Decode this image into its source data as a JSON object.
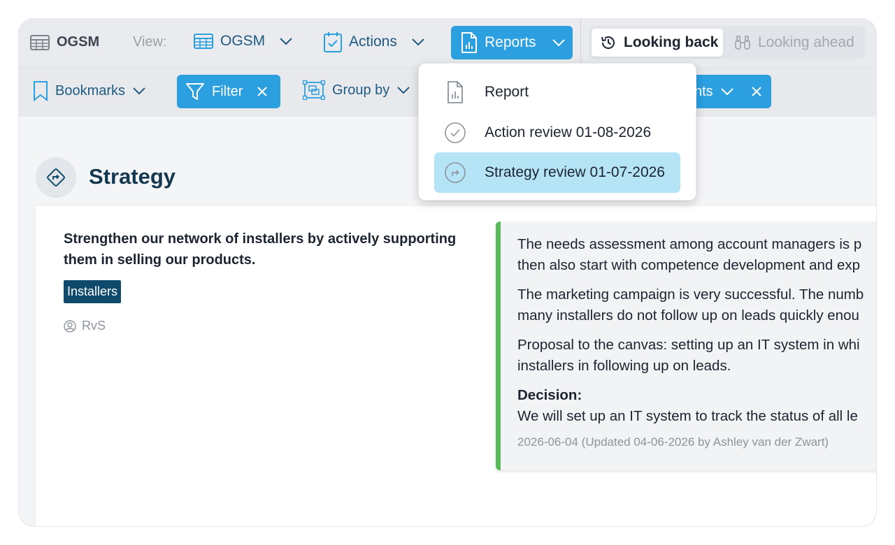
{
  "header": {
    "app_title": "OGSM",
    "view_label": "View:",
    "view_value": "OGSM",
    "actions_label": "Actions",
    "reports_label": "Reports",
    "looking_back": "Looking back",
    "looking_ahead": "Looking ahead"
  },
  "toolbar": {
    "bookmarks": "Bookmarks",
    "filter": "Filter",
    "group_by": "Group by",
    "elements_partial": "nts"
  },
  "reports_menu": {
    "items": [
      {
        "label": "Report",
        "icon": "report-document-icon"
      },
      {
        "label": "Action review 01-08-2026",
        "icon": "check-circle-icon"
      },
      {
        "label": "Strategy review 01-07-2026",
        "icon": "strategy-arrow-circle-icon",
        "selected": true
      }
    ]
  },
  "section": {
    "title": "Strategy"
  },
  "strategy": {
    "objective": "Strengthen our network of installers by actively supporting them in selling our products.",
    "tag": "Installers",
    "owner": "RvS"
  },
  "review": {
    "p1_line1": "The needs assessment among account managers is p",
    "p1_line2": "then also start with competence development and exp",
    "p2_line1": "The marketing campaign is very successful. The numb",
    "p2_line2": "many installers do not follow up on leads quickly enou",
    "p3_line1": "Proposal to the canvas: setting up an IT system in whi",
    "p3_line2": "installers in following up on leads.",
    "decision_heading": "Decision:",
    "decision_text": "We will set up an IT system to track the status of all le",
    "meta": "2026-06-04 (Updated 04-06-2026 by Ashley van der Zwart)"
  },
  "colors": {
    "accent": "#2b9fe0",
    "navy": "#0f4a6c",
    "success": "#5cb85c",
    "selected_item": "#b5e4f7"
  }
}
